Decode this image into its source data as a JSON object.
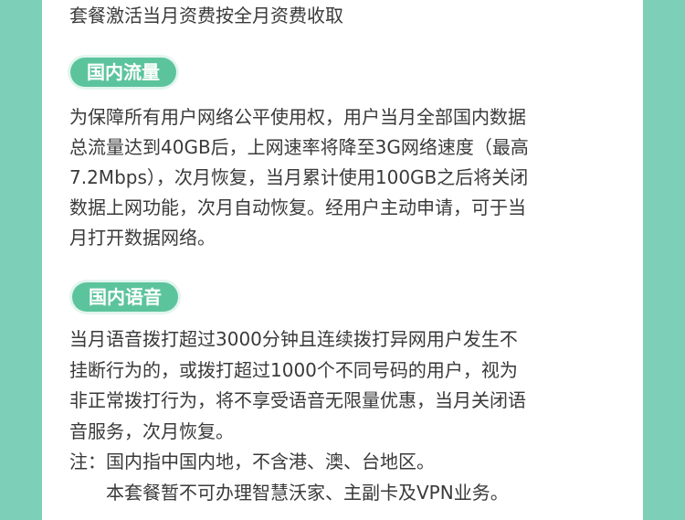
{
  "intro": "套餐激活当月资费按全月资费收取",
  "section_data": {
    "title": "国内流量",
    "lines": [
      "为保障所有用户网络公平使用权，用户当月全部国内数据",
      "总流量达到40GB后，上网速率将降至3G网络速度（最高",
      "7.2Mbps），次月恢复，当月累计使用100GB之后将关闭",
      "数据上网功能，次月自动恢复。经用户主动申请，可于当",
      "月打开数据网络。"
    ]
  },
  "section_voice": {
    "title": "国内语音",
    "lines": [
      "当月语音拨打超过3000分钟且连续拨打异网用户发生不",
      "挂断行为的，或拨打超过1000个不同号码的用户，视为",
      "非正常拨打行为，将不享受语音无限量优惠，当月关闭语",
      "音服务，次月恢复。",
      "注：国内指中国内地，不含港、澳、台地区。",
      "　　本套餐暂不可办理智慧沃家、主副卡及VPN业务。"
    ]
  },
  "colors": {
    "background": "#7ecfb7",
    "card": "#ffffff",
    "pill": "#5cc49c",
    "pill_halo": "#e3f5ef",
    "text": "#3a3a3a"
  }
}
